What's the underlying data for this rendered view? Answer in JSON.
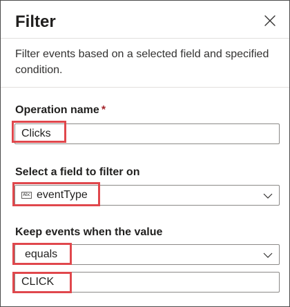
{
  "panel": {
    "title": "Filter",
    "close_icon": "close-icon",
    "description": "Filter events based on a selected field and specified condition."
  },
  "operation": {
    "label": "Operation name",
    "required_marker": "*",
    "value": "Clicks"
  },
  "filter_field": {
    "label": "Select a field to filter on",
    "type_icon_text": "Abc",
    "selected": "eventType",
    "dropdown_icon": "chevron-down-icon"
  },
  "condition": {
    "label": "Keep events when the value",
    "operator_selected": "equals",
    "dropdown_icon": "chevron-down-icon",
    "value": "CLICK"
  },
  "colors": {
    "highlight": "#e0474c",
    "required": "#a4262c",
    "border": "#8a8886"
  }
}
